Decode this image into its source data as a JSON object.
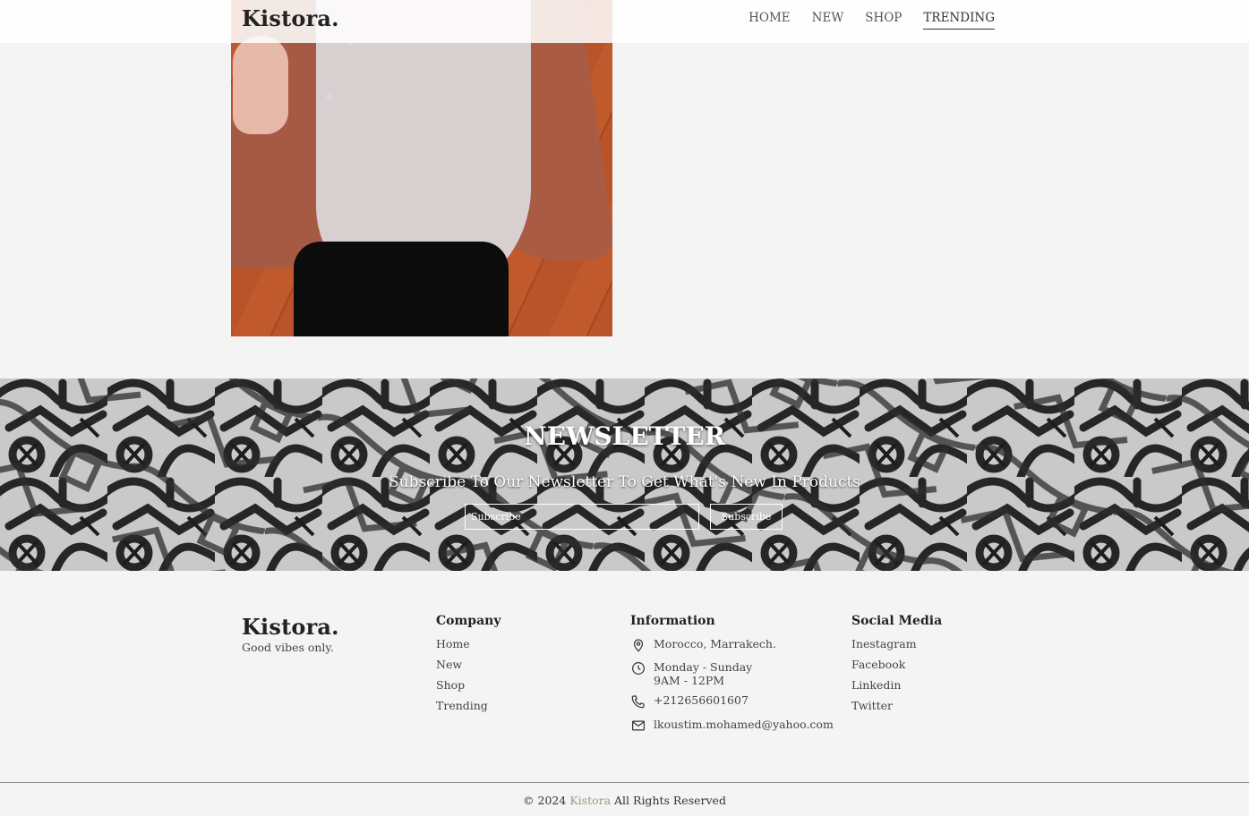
{
  "header": {
    "logo": "Kistora.",
    "nav": [
      "HOME",
      "NEW",
      "SHOP",
      "TRENDING"
    ],
    "active_nav": "TRENDING"
  },
  "newsletter": {
    "title": "NEWSLETTER",
    "subtitle": "Subscribe To Our Newsletter To Get What's New In Products",
    "input_placeholder": "Subscribe",
    "button_label": "Subscribe"
  },
  "footer": {
    "logo": "Kistora.",
    "tagline": "Good vibes only.",
    "company": {
      "heading": "Company",
      "links": [
        "Home",
        "New",
        "Shop",
        "Trending"
      ]
    },
    "information": {
      "heading": "Information",
      "location": "Morocco, Marrakech.",
      "hours_days": "Monday - Sunday",
      "hours_time": "9AM - 12PM",
      "phone": "+212656601607",
      "email": "lkoustim.mohamed@yahoo.com"
    },
    "social": {
      "heading": "Social Media",
      "links": [
        "Inestagram",
        "Facebook",
        "Linkedin",
        "Twitter"
      ]
    },
    "copyright": {
      "prefix": "© 2024",
      "brand": "Kistora",
      "suffix": "All Rights Reserved"
    }
  },
  "colors": {
    "background": "#f4f4f4",
    "brand_accent": "#9c9a7c",
    "text": "#222222"
  },
  "icons": [
    "location-pin-icon",
    "clock-icon",
    "phone-icon",
    "mail-icon"
  ]
}
